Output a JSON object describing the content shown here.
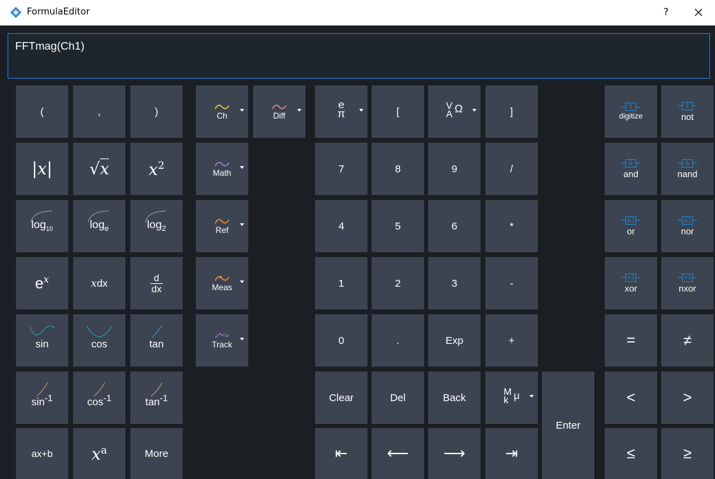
{
  "window": {
    "title": "FormulaEditor",
    "help_label": "?",
    "close_label": "✕"
  },
  "formula": {
    "value": "FFTmag(Ch1)"
  },
  "keys": {
    "paren_open": "(",
    "comma": ",",
    "paren_close": ")",
    "ch": "Ch",
    "diff": "Diff",
    "epi_top": "e",
    "epi_bottom": "π",
    "bracket_open": "[",
    "units_v": "V",
    "units_a": "A",
    "units_omega": "Ω",
    "bracket_close": "]",
    "digitize": "digitize",
    "not": "not",
    "abs": "|x|",
    "sqrt_x": "x",
    "x_sq_base": "x",
    "x_sq_exp": "2",
    "math": "Math",
    "seven": "7",
    "eight": "8",
    "nine": "9",
    "divide": "/",
    "and": "and",
    "nand": "nand",
    "log10": "log",
    "log10_sub": "10",
    "loge": "log",
    "loge_sub": "e",
    "log2": "log",
    "log2_sub": "2",
    "ref": "Ref",
    "four": "4",
    "five": "5",
    "six": "6",
    "multiply": "*",
    "or": "or",
    "nor": "nor",
    "exp_e": "e",
    "exp_x": "x",
    "integ_x": "x",
    "integ_dx": "dx",
    "deriv_top": "d",
    "deriv_bottom": "dx",
    "meas": "Meas",
    "one": "1",
    "two": "2",
    "three": "3",
    "minus": "-",
    "xor": "xor",
    "nxor": "nxor",
    "sin": "sin",
    "cos": "cos",
    "tan": "tan",
    "track": "Track",
    "zero": "0",
    "dot": ".",
    "exp": "Exp",
    "plus": "+",
    "equals": "=",
    "not_equal": "≠",
    "asin": "sin",
    "acos": "cos",
    "atan": "tan",
    "inv_exp": "-1",
    "clear": "Clear",
    "del": "Del",
    "back": "Back",
    "prefix_m": "M",
    "prefix_k": "k",
    "prefix_mu": "μ",
    "enter": "Enter",
    "less": "<",
    "greater": ">",
    "linear": "ax+b",
    "power_base": "x",
    "power_exp": "a",
    "more": "More",
    "home": "⇤",
    "left": "⟵",
    "right": "⟶",
    "end": "⇥",
    "less_equal": "≤",
    "greater_equal": "≥"
  },
  "gate_symbols": {
    "digitize": "1",
    "not": "1",
    "and": "&",
    "nand": "&",
    "or": "≥1",
    "nor": "≥1",
    "xor": "=1",
    "nxor": "=1"
  },
  "colors": {
    "accent": "#1e86d4",
    "key_bg": "#3b4450",
    "background": "#1b1e23",
    "ch_curve": "#e3d33b",
    "diff_curve": "#e88a8a",
    "math_curve": "#b084e0",
    "ref_curve": "#f08a3c",
    "meas_curve": "#f08a3c",
    "track_curve": "#c58ae6",
    "trig_curve": "#2aa6b8",
    "log_curve": "#9aa0a6"
  },
  "icons": {
    "app": "formula-editor-icon",
    "help": "help-icon",
    "close": "close-icon"
  }
}
